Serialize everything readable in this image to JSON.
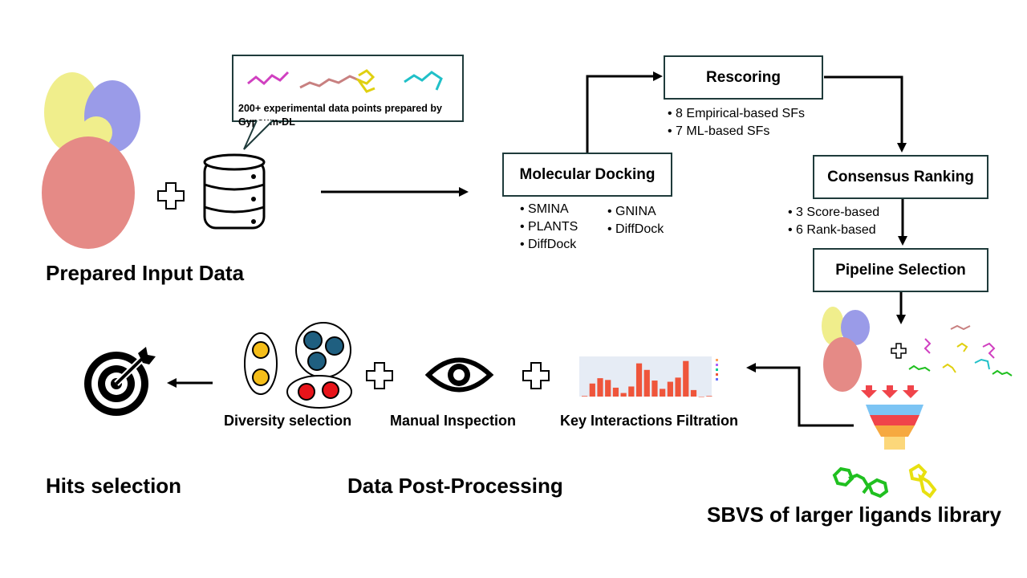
{
  "input": {
    "title": "Prepared Input Data",
    "callout": "200+ experimental data points prepared by Gypsum-DL"
  },
  "docking": {
    "title": "Molecular Docking",
    "tools_col1": [
      "SMINA",
      "PLANTS",
      "DiffDock"
    ],
    "tools_col2": [
      "GNINA",
      "DiffDock"
    ]
  },
  "rescoring": {
    "title": "Rescoring",
    "items": [
      "8 Empirical-based SFs",
      "7 ML-based SFs"
    ]
  },
  "consensus": {
    "title": "Consensus Ranking",
    "items": [
      "3 Score-based",
      "6 Rank-based"
    ]
  },
  "pipeline": {
    "title": "Pipeline Selection"
  },
  "sbvs": {
    "title": "SBVS of larger ligands library"
  },
  "postprocessing": {
    "title": "Data Post-Processing",
    "steps": [
      "Diversity selection",
      "Manual Inspection",
      "Key Interactions Filtration"
    ]
  },
  "hits": {
    "title": "Hits selection"
  },
  "thumbnail_chart": {
    "values": [
      1,
      22,
      31,
      28,
      15,
      6,
      17,
      56,
      45,
      27,
      13,
      25,
      32,
      60,
      11,
      0,
      1
    ]
  },
  "colors": {
    "protein_yellow": "#f0ee8c",
    "protein_blue": "#9a9be8",
    "protein_red": "#e58a86",
    "box_border": "#1f3b3b",
    "cluster_blue": "#1f5f80",
    "cluster_yellow": "#f5be1a",
    "cluster_red": "#e8141a",
    "funnel_arrow": "#f0444a"
  }
}
